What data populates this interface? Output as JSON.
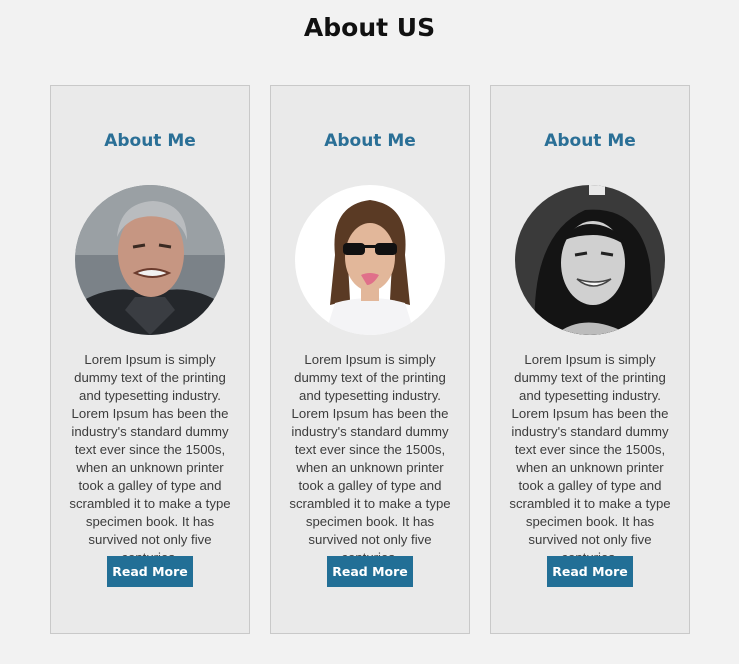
{
  "page_title": "About US",
  "accent_color": "#226f96",
  "cards": [
    {
      "heading": "About Me",
      "avatar_icon": "man-portrait-icon",
      "text": "Lorem Ipsum is simply dummy text of the printing and typesetting industry. Lorem Ipsum has been the industry's standard dummy text ever since the 1500s, when an unknown printer took a galley of type and scrambled it to make a type specimen book. It has survived not only five centuries,",
      "button_label": "Read More"
    },
    {
      "heading": "About Me",
      "avatar_icon": "man-sunglasses-portrait-icon",
      "text": "Lorem Ipsum is simply dummy text of the printing and typesetting industry. Lorem Ipsum has been the industry's standard dummy text ever since the 1500s, when an unknown printer took a galley of type and scrambled it to make a type specimen book. It has survived not only five centuries,",
      "button_label": "Read More"
    },
    {
      "heading": "About Me",
      "avatar_icon": "woman-portrait-icon",
      "text": "Lorem Ipsum is simply dummy text of the printing and typesetting industry. Lorem Ipsum has been the industry's standard dummy text ever since the 1500s, when an unknown printer took a galley of type and scrambled it to make a type specimen book. It has survived not only five centuries,",
      "button_label": "Read More"
    }
  ]
}
